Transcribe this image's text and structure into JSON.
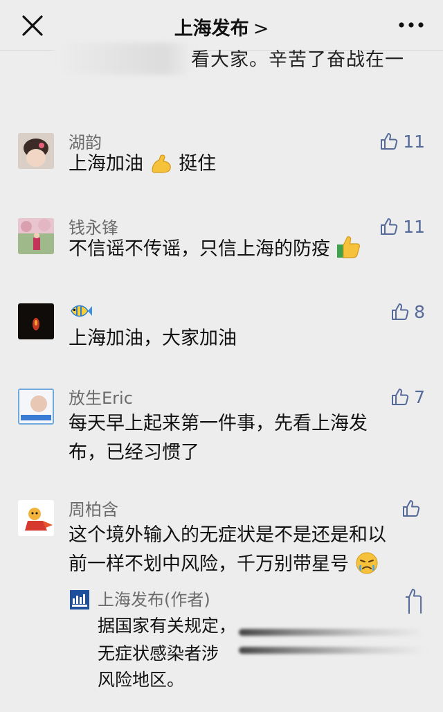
{
  "header": {
    "title": "上海发布",
    "chevron": ">"
  },
  "partial_text": "看大家。辛苦了奋战在一",
  "comments": [
    {
      "nick": "湖韵",
      "lines": [
        "上海加油",
        "挺住"
      ],
      "likes": "11"
    },
    {
      "nick": "钱永锋",
      "lines": [
        "不信谣不传谣，只信上海的防疫"
      ],
      "likes": "11"
    },
    {
      "nick": "",
      "lines": [
        "上海加油，大家加油"
      ],
      "likes": "8"
    },
    {
      "nick": "放生Eric",
      "lines": [
        "每天早上起来第一件事，先看上海发",
        "布，已经习惯了"
      ],
      "likes": "7"
    },
    {
      "nick": "周柏含",
      "lines": [
        "这个境外输入的无症状是不是还是和以",
        "前一样不划中风险，千万别带星号"
      ],
      "likes": ""
    }
  ],
  "reply": {
    "nick": "上海发布(作者)",
    "lines": [
      "据国家有关规定，",
      "无症状感染者涉",
      "风险地区。"
    ]
  },
  "colors": {
    "background": "#ededed",
    "like_color": "#566a9a",
    "nick_color": "#6b6b6b"
  }
}
